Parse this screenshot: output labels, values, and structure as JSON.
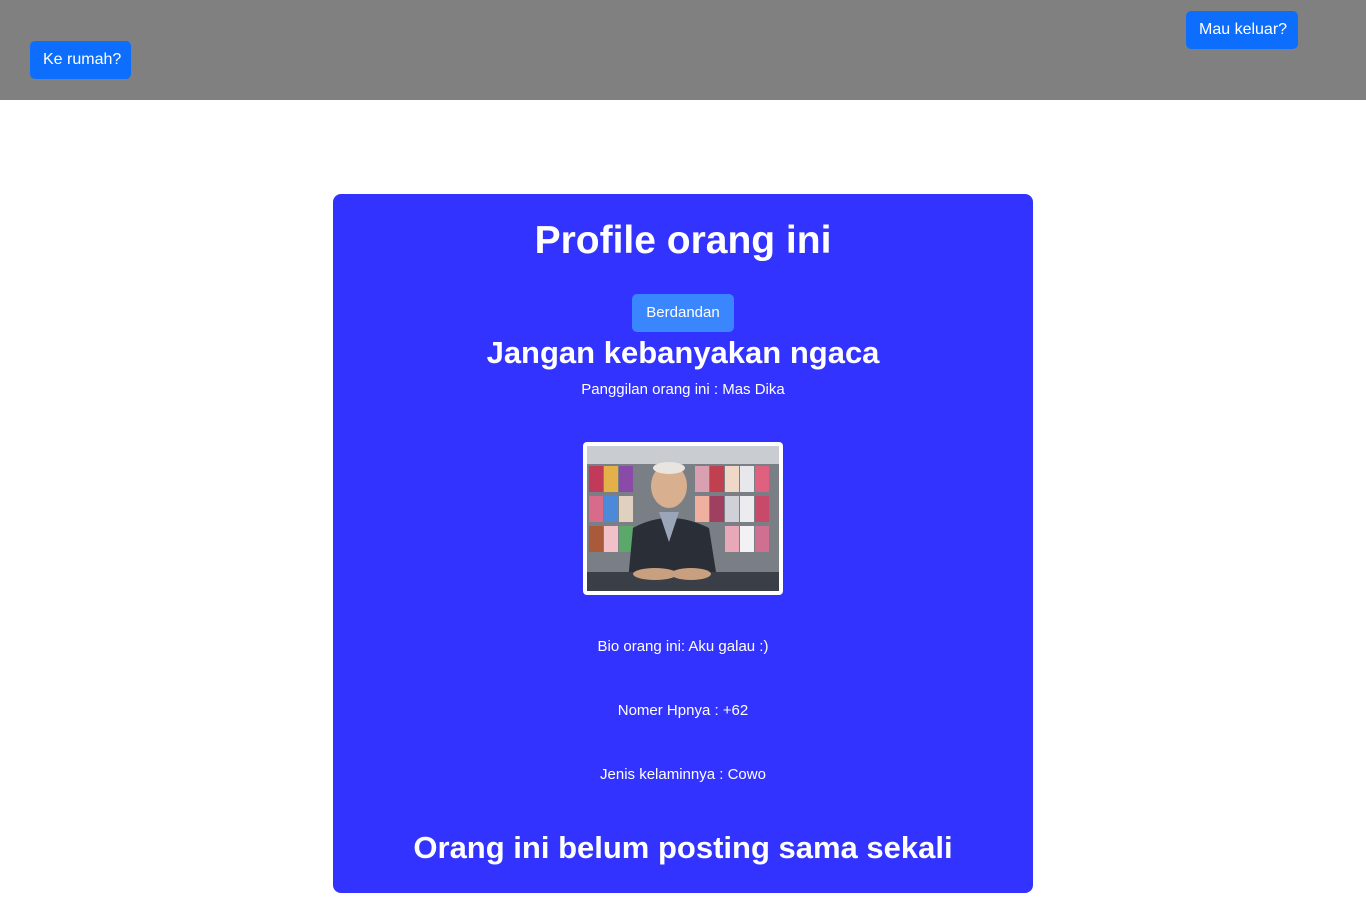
{
  "nav": {
    "home_label": "Ke rumah?",
    "logout_label": "Mau keluar?"
  },
  "profile": {
    "title": "Profile orang ini",
    "dress_button_label": "Berdandan",
    "subtitle": "Jangan kebanyakan ngaca",
    "nickname": "Panggilan orang ini : Mas Dika",
    "photo_alt": "profile-photo",
    "bio": "Bio orang ini: Aku galau :)",
    "phone": "Nomer Hpnya : +62",
    "gender": "Jenis kelaminnya : Cowo",
    "no_posts": "Orang ini belum posting sama sekali"
  },
  "colors": {
    "topbar": "#808080",
    "primary_button": "#0d6efd",
    "card": "#3333ff",
    "secondary_button": "#3a86ff"
  }
}
